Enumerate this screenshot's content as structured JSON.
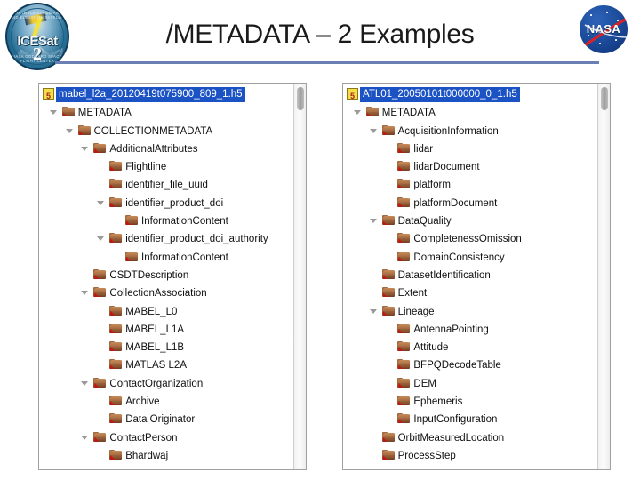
{
  "header": {
    "title": "/METADATA – 2 Examples",
    "left_logo_name": "ICESat-2 mission patch",
    "left_logo_wordmark": "ICESat",
    "left_logo_number": "2",
    "left_logo_arc_top": "EARTH ICE CLOUD AND LAND ELEVATION SATELLITE",
    "left_logo_arc_bottom": "NASA GODDARD SPACE FLIGHT CENTER",
    "right_logo_word": "NASA",
    "divider_color": "#6b7fb5"
  },
  "panels": [
    {
      "name": "left-tree-panel",
      "root": {
        "label": "mabel_l2a_20120419t075900_809_1.h5",
        "selected": true,
        "icon": "h5-file-icon"
      },
      "nodes": [
        {
          "label": "METADATA",
          "depth": 1,
          "expanded": true
        },
        {
          "label": "COLLECTIONMETADATA",
          "depth": 2,
          "expanded": true
        },
        {
          "label": "AdditionalAttributes",
          "depth": 3,
          "expanded": true
        },
        {
          "label": "Flightline",
          "depth": 4,
          "expanded": false
        },
        {
          "label": "identifier_file_uuid",
          "depth": 4,
          "expanded": false
        },
        {
          "label": "identifier_product_doi",
          "depth": 4,
          "expanded": true
        },
        {
          "label": "InformationContent",
          "depth": 5,
          "expanded": false
        },
        {
          "label": "identifier_product_doi_authority",
          "depth": 4,
          "expanded": true
        },
        {
          "label": "InformationContent",
          "depth": 5,
          "expanded": false
        },
        {
          "label": "CSDTDescription",
          "depth": 3,
          "expanded": false
        },
        {
          "label": "CollectionAssociation",
          "depth": 3,
          "expanded": true
        },
        {
          "label": "MABEL_L0",
          "depth": 4,
          "expanded": false
        },
        {
          "label": "MABEL_L1A",
          "depth": 4,
          "expanded": false
        },
        {
          "label": "MABEL_L1B",
          "depth": 4,
          "expanded": false
        },
        {
          "label": "MATLAS L2A",
          "depth": 4,
          "expanded": false
        },
        {
          "label": "ContactOrganization",
          "depth": 3,
          "expanded": true
        },
        {
          "label": "Archive",
          "depth": 4,
          "expanded": false
        },
        {
          "label": "Data Originator",
          "depth": 4,
          "expanded": false
        },
        {
          "label": "ContactPerson",
          "depth": 3,
          "expanded": true
        },
        {
          "label": "Bhardwaj",
          "depth": 4,
          "expanded": false
        }
      ]
    },
    {
      "name": "right-tree-panel",
      "root": {
        "label": "ATL01_20050101t000000_0_1.h5",
        "selected": true,
        "icon": "h5-file-icon"
      },
      "nodes": [
        {
          "label": "METADATA",
          "depth": 1,
          "expanded": true
        },
        {
          "label": "AcquisitionInformation",
          "depth": 2,
          "expanded": true
        },
        {
          "label": "lidar",
          "depth": 3,
          "expanded": false
        },
        {
          "label": "lidarDocument",
          "depth": 3,
          "expanded": false
        },
        {
          "label": "platform",
          "depth": 3,
          "expanded": false
        },
        {
          "label": "platformDocument",
          "depth": 3,
          "expanded": false
        },
        {
          "label": "DataQuality",
          "depth": 2,
          "expanded": true
        },
        {
          "label": "CompletenessOmission",
          "depth": 3,
          "expanded": false
        },
        {
          "label": "DomainConsistency",
          "depth": 3,
          "expanded": false
        },
        {
          "label": "DatasetIdentification",
          "depth": 2,
          "expanded": false
        },
        {
          "label": "Extent",
          "depth": 2,
          "expanded": false
        },
        {
          "label": "Lineage",
          "depth": 2,
          "expanded": true
        },
        {
          "label": "AntennaPointing",
          "depth": 3,
          "expanded": false
        },
        {
          "label": "Attitude",
          "depth": 3,
          "expanded": false
        },
        {
          "label": "BFPQDecodeTable",
          "depth": 3,
          "expanded": false
        },
        {
          "label": "DEM",
          "depth": 3,
          "expanded": false
        },
        {
          "label": "Ephemeris",
          "depth": 3,
          "expanded": false
        },
        {
          "label": "InputConfiguration",
          "depth": 3,
          "expanded": false
        },
        {
          "label": "OrbitMeasuredLocation",
          "depth": 2,
          "expanded": false
        },
        {
          "label": "ProcessStep",
          "depth": 2,
          "expanded": false
        }
      ]
    }
  ],
  "colors": {
    "selection_blue": "#1b52c4",
    "folder_brown": "#8d5531",
    "panel_border": "#a0a0a0"
  }
}
